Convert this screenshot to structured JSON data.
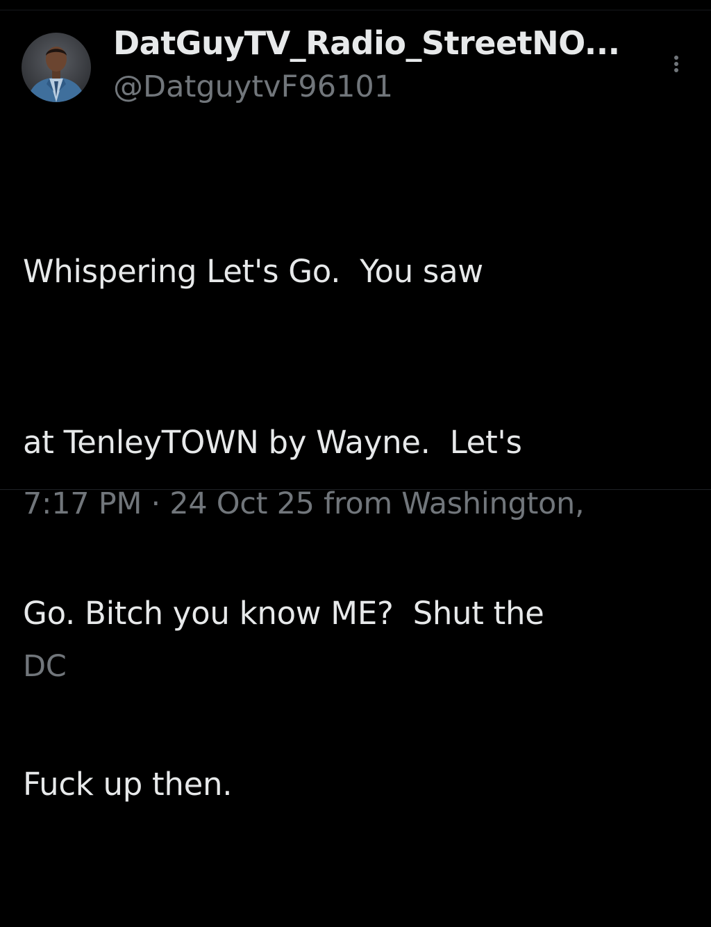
{
  "tweet": {
    "author": {
      "display_name": "DatGuyTV_Radio_StreetNO...",
      "handle": "@DatguytvF96101",
      "avatar_icon": "profile-photo"
    },
    "more_icon": "vertical-ellipsis-icon",
    "text_lines": [
      "Whispering Let's Go.  You saw",
      "at TenleyTOWN by Wayne.  Let's",
      "Go. Bitch you know ME?  Shut the",
      "Fuck up then."
    ],
    "meta_lines": [
      "7:17 PM · 24 Oct 25 from Washington,",
      "DC"
    ]
  },
  "colors": {
    "background": "#000000",
    "primary_text": "#e7e9ea",
    "secondary_text": "#71767b"
  }
}
